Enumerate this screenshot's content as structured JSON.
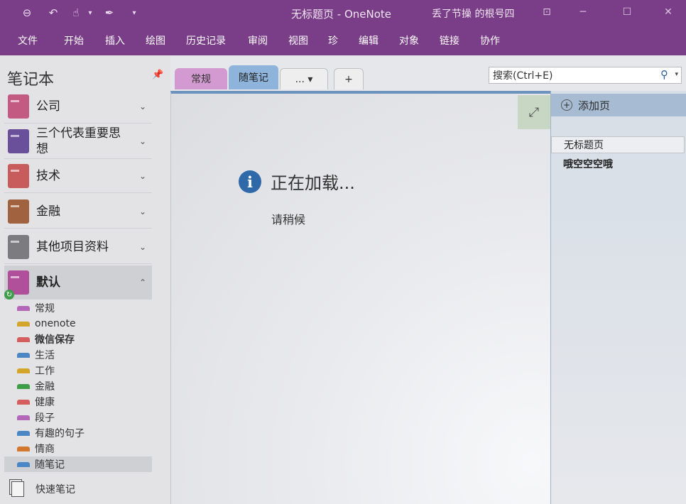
{
  "titlebar": {
    "title": "无标题页  -  OneNote",
    "user": "丢了节操 的根号四",
    "quick_access": [
      {
        "name": "back-icon",
        "glyph": "⊖"
      },
      {
        "name": "undo-icon",
        "glyph": "↶"
      },
      {
        "name": "touch-mode-icon",
        "glyph": "☝"
      },
      {
        "name": "pen-icon",
        "glyph": "✒"
      },
      {
        "name": "customize-icon",
        "glyph": "▾"
      }
    ],
    "buttons": {
      "restore": "⊡",
      "minimize": "─",
      "maximize": "☐",
      "close": "✕"
    }
  },
  "ribbon": {
    "menu": [
      "文件",
      "开始",
      "插入",
      "绘图",
      "历史记录",
      "审阅",
      "视图",
      "珍",
      "编辑",
      "对象",
      "链接",
      "协作"
    ]
  },
  "nav": {
    "title": "笔记本",
    "notebooks": [
      {
        "label": "公司",
        "color": "#c25a82",
        "chevron": "⌄"
      },
      {
        "label": "三个代表重要思想",
        "color": "#6a4f9a",
        "chevron": "⌄"
      },
      {
        "label": "技术",
        "color": "#c85b5b",
        "chevron": "⌄"
      },
      {
        "label": "金融",
        "color": "#a1633f",
        "chevron": "⌄"
      },
      {
        "label": "其他项目资料",
        "color": "#7c7c80",
        "chevron": "⌄"
      },
      {
        "label": "默认",
        "color": "#b04f9a",
        "chevron": "⌃"
      }
    ],
    "sections": [
      {
        "label": "常规",
        "color": "#b466b8"
      },
      {
        "label": "onenote",
        "color": "#d3a52b"
      },
      {
        "label": "微信保存",
        "color": "#d45d5d"
      },
      {
        "label": "生活",
        "color": "#4b86c5"
      },
      {
        "label": "工作",
        "color": "#d3a52b"
      },
      {
        "label": "金融",
        "color": "#3f9d4a"
      },
      {
        "label": "健康",
        "color": "#d45d5d"
      },
      {
        "label": "段子",
        "color": "#b466b8"
      },
      {
        "label": "有趣的句子",
        "color": "#4b86c5"
      },
      {
        "label": "情商",
        "color": "#d2782f"
      },
      {
        "label": "随笔记",
        "color": "#4b86c5"
      }
    ],
    "quick_notes": "快速笔记"
  },
  "section_tabs": [
    {
      "label": "常规",
      "color": "#d39ad2"
    },
    {
      "label": "随笔记",
      "color": "#8fb4dc"
    },
    {
      "label": "... ▾",
      "color": "#eeeeef"
    },
    {
      "label": "+",
      "color": "#eeeeef"
    }
  ],
  "search": {
    "placeholder": "搜索(Ctrl+E)",
    "icon": "⚲",
    "caret": "▾"
  },
  "page": {
    "expand_icon": "⤢",
    "info_glyph": "i",
    "loading": "正在加载...",
    "wait": "请稍候"
  },
  "pagelist": {
    "add_label": "添加页",
    "add_glyph": "+",
    "pages": [
      {
        "label": "无标题页",
        "selected": true
      },
      {
        "label": "哦空空空哦",
        "selected": false
      }
    ]
  }
}
